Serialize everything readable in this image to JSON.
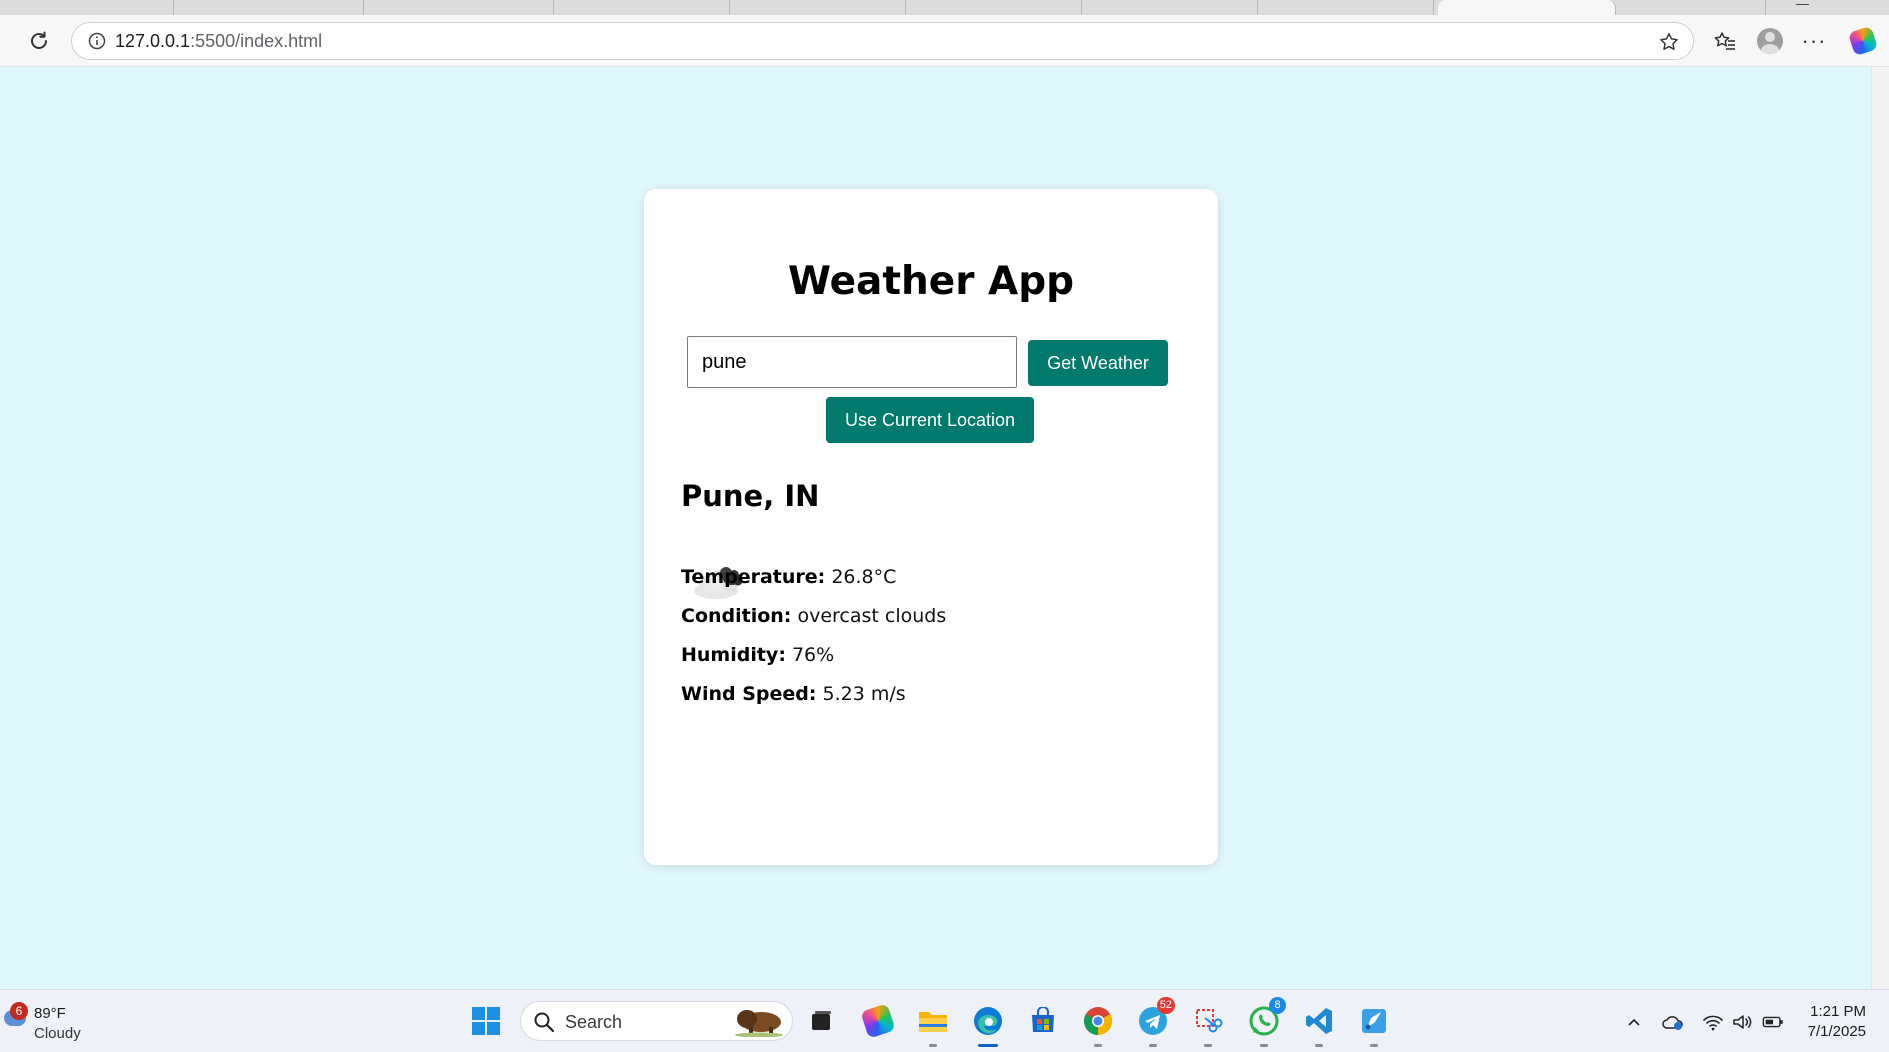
{
  "browser": {
    "url_host": "127.0.0.1",
    "url_path": ":5500/index.html"
  },
  "app": {
    "title": "Weather App",
    "city_input_value": "pune",
    "get_weather_label": "Get Weather",
    "use_location_label": "Use Current Location",
    "accent_color": "#007a6c",
    "background_color": "#dff6fc"
  },
  "weather": {
    "location": "Pune, IN",
    "icon": "overcast-clouds-icon",
    "temperature_label": "Temperature:",
    "temperature_value": "26.8°C",
    "condition_label": "Condition:",
    "condition_value": "overcast clouds",
    "humidity_label": "Humidity:",
    "humidity_value": "76%",
    "wind_label": "Wind Speed:",
    "wind_value": "5.23 m/s"
  },
  "taskbar": {
    "weather_badge": "6",
    "weather_temp": "89°F",
    "weather_condition": "Cloudy",
    "search_placeholder": "Search",
    "telegram_badge": "52",
    "whatsapp_badge": "8",
    "time": "1:21 PM",
    "date": "7/1/2025"
  }
}
